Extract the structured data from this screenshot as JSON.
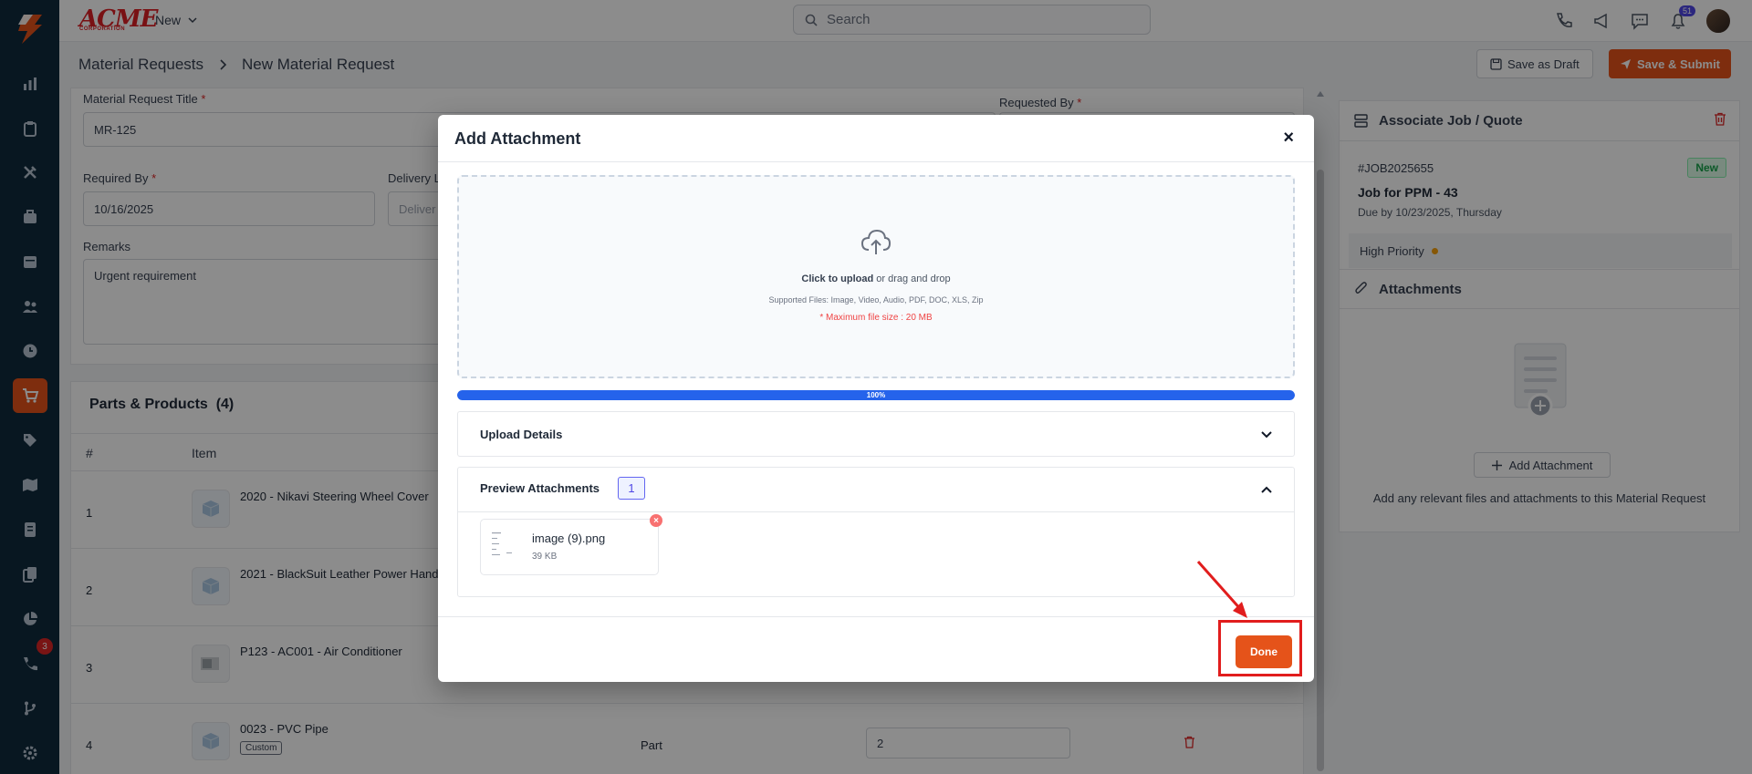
{
  "app": {
    "brand": "ACME",
    "brand_sub": "CORPORATION",
    "new_menu_label": "New",
    "search_placeholder": "Search",
    "notification_count": "51",
    "sidebar_badge_count": "3",
    "accent_color": "#e5531a"
  },
  "sidebar": {
    "icons": [
      "logo-icon",
      "dashboard-icon",
      "clipboard-icon",
      "tools-icon",
      "briefcase-icon",
      "calendar-icon",
      "people-icon",
      "clock-icon",
      "cart-icon",
      "tag-icon",
      "map-icon",
      "invoice-icon",
      "documents-icon",
      "pie-chart-icon",
      "phone-badge-icon",
      "branch-icon",
      "settings-icon"
    ],
    "active": "cart-icon"
  },
  "breadcrumb": {
    "parent": "Material Requests",
    "current": "New Material Request"
  },
  "actions": {
    "save_draft": "Save as Draft",
    "save_submit": "Save & Submit"
  },
  "form": {
    "title_label": "Material Request Title",
    "title_value": "MR-125",
    "requested_by_label": "Requested By",
    "required_by_label": "Required By",
    "required_by_value": "10/16/2025",
    "delivery_label": "Delivery L",
    "delivery_placeholder": "Deliver",
    "remarks_label": "Remarks",
    "remarks_value": "Urgent requirement",
    "required_marker": "*"
  },
  "parts": {
    "title": "Parts & Products",
    "count": "(4)",
    "col_num": "#",
    "col_item": "Item",
    "rows": [
      {
        "num": "1",
        "name": "2020 - Nikavi Steering Wheel Cover"
      },
      {
        "num": "2",
        "name": "2021 - BlackSuit Leather Power Hand"
      },
      {
        "num": "3",
        "name": "P123 - AC001 - Air Conditioner"
      },
      {
        "num": "4",
        "name": "0023 - PVC Pipe",
        "tag": "Custom",
        "type": "Part",
        "qty": "2"
      }
    ]
  },
  "right_panel": {
    "job_header": "Associate Job / Quote",
    "job_id": "#JOB2025655",
    "job_status": "New",
    "job_title": "Job for PPM - 43",
    "job_due": "Due by 10/23/2025, Thursday",
    "priority": "High Priority",
    "attachments_header": "Attachments",
    "add_attachment": "Add Attachment",
    "help_text": "Add any relevant files and attachments to this Material Request"
  },
  "modal": {
    "title": "Add Attachment",
    "close": "×",
    "upload_click": "Click to upload",
    "upload_rest": " or drag and drop",
    "supported": "Supported Files: Image, Video, Audio, PDF, DOC, XLS, Zip",
    "max_size": "* Maximum file size : 20 MB",
    "progress_label": "100%",
    "progress_value": 1.0,
    "upload_details": "Upload Details",
    "preview_attachments": "Preview Attachments",
    "preview_count": "1",
    "file_name": "image (9).png",
    "file_size": "39 KB",
    "done": "Done"
  }
}
